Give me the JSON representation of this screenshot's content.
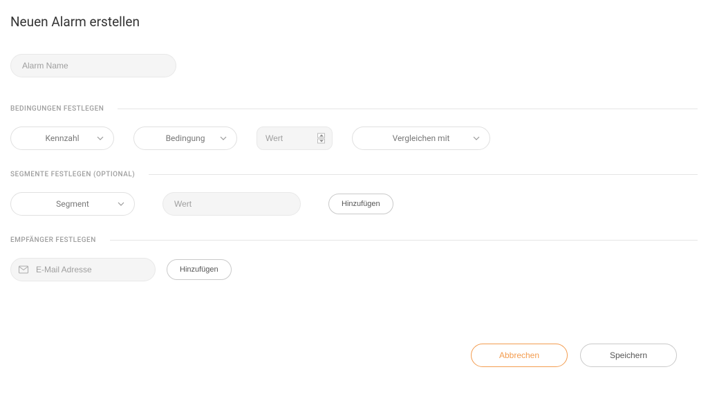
{
  "page": {
    "title": "Neuen Alarm erstellen"
  },
  "alarmName": {
    "placeholder": "Alarm Name",
    "value": ""
  },
  "sections": {
    "conditions": {
      "header": "BEDINGUNGEN FESTLEGEN",
      "metric": {
        "label": "Kennzahl"
      },
      "condition": {
        "label": "Bedingung"
      },
      "valueInput": {
        "placeholder": "Wert",
        "value": ""
      },
      "compare": {
        "label": "Vergleichen mit"
      }
    },
    "segments": {
      "header": "SEGMENTE FESTLEGEN (OPTIONAL)",
      "segment": {
        "label": "Segment"
      },
      "valueInput": {
        "placeholder": "Wert",
        "value": ""
      },
      "addButton": "Hinzufügen"
    },
    "recipients": {
      "header": "EMPFÄNGER FESTLEGEN",
      "emailInput": {
        "placeholder": "E-Mail Adresse",
        "value": ""
      },
      "addButton": "Hinzufügen"
    }
  },
  "footer": {
    "cancel": "Abbrechen",
    "save": "Speichern"
  }
}
